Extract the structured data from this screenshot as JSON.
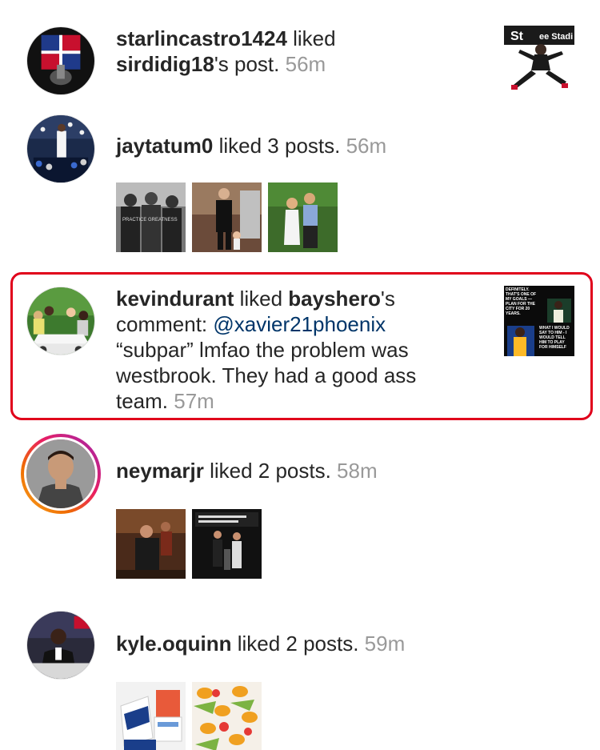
{
  "items": [
    {
      "user": "starlincastro1424",
      "action": " liked ",
      "target": "sirdidig18",
      "suffix": "'s post. ",
      "time": "56m"
    },
    {
      "user": "jaytatum0",
      "action": " liked 3 posts. ",
      "time": "56m"
    },
    {
      "user": "kevindurant",
      "action": " liked ",
      "target": "bayshero",
      "suffix": "'s",
      "comment_prefix": "comment: ",
      "mention": "@xavier21phoenix",
      "comment_line2": "“subpar” lmfao the problem was",
      "comment_line3": "westbrook. They had a good ass",
      "comment_line4": "team. ",
      "time": "57m",
      "thumb_text": "DEFINITELY. THAT'S ONE OF MY GOALS — PLAN FOR THE CITY FOR 20 YEARS.",
      "thumb_text2": "WHAT I WOULD SAY TO HIM - I WOULD TELL HIM TO PLAY FOR HIMSELF"
    },
    {
      "user": "neymarjr",
      "action": " liked 2 posts. ",
      "time": "58m"
    },
    {
      "user": "kyle.oquinn",
      "action": " liked 2 posts. ",
      "time": "59m"
    }
  ],
  "thumb_sign": "St",
  "thumb_sign2": "ee Stadi",
  "thumb_jersey": "PRACTICE GREATNESS",
  "colors": {
    "text": "#262626",
    "time": "#999999",
    "mention": "#003569",
    "highlight": "#e0001b"
  }
}
